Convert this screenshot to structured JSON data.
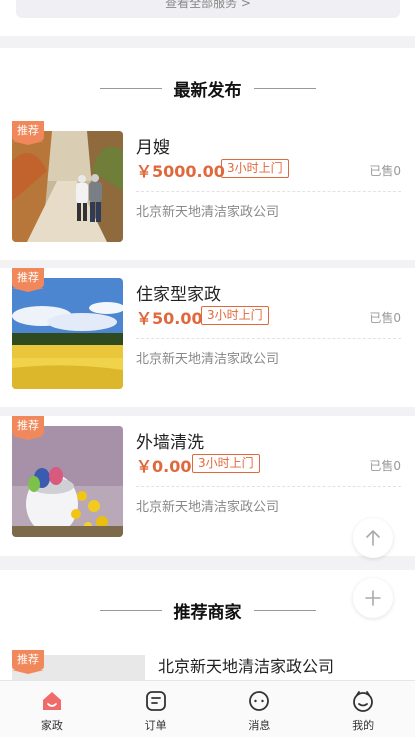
{
  "top": {
    "view_all": "查看全部服务 >"
  },
  "sections": {
    "latest": "最新发布",
    "merchants": "推荐商家"
  },
  "tag_label": "推荐",
  "listings": [
    {
      "title": "月嫂",
      "price": "￥5000.00",
      "badge": "3小时上门",
      "sold": "已售0",
      "company": "北京新天地清洁家政公司",
      "image": "elderly-couple-autumn-path"
    },
    {
      "title": "住家型家政",
      "price": "￥50.00",
      "badge": "3小时上门",
      "sold": "已售0",
      "company": "北京新天地清洁家政公司",
      "image": "rapeseed-field-blue-sky"
    },
    {
      "title": "外墙清洗",
      "price": "￥0.00",
      "badge": "3小时上门",
      "sold": "已售0",
      "company": "北京新天地清洁家政公司",
      "image": "easter-eggs-yellow-flowers"
    }
  ],
  "merchant": {
    "name": "北京新天地清洁家政公司"
  },
  "floating": {
    "up_icon": "arrow-up-icon",
    "plus_icon": "plus-icon"
  },
  "tabs": [
    {
      "label": "家政",
      "icon": "home-icon",
      "active": true
    },
    {
      "label": "订单",
      "icon": "order-icon",
      "active": false
    },
    {
      "label": "消息",
      "icon": "message-icon",
      "active": false
    },
    {
      "label": "我的",
      "icon": "profile-icon",
      "active": false
    }
  ],
  "colors": {
    "accent": "#e0683c",
    "tag": "#f0885b",
    "active_tab": "#f06a6a"
  }
}
